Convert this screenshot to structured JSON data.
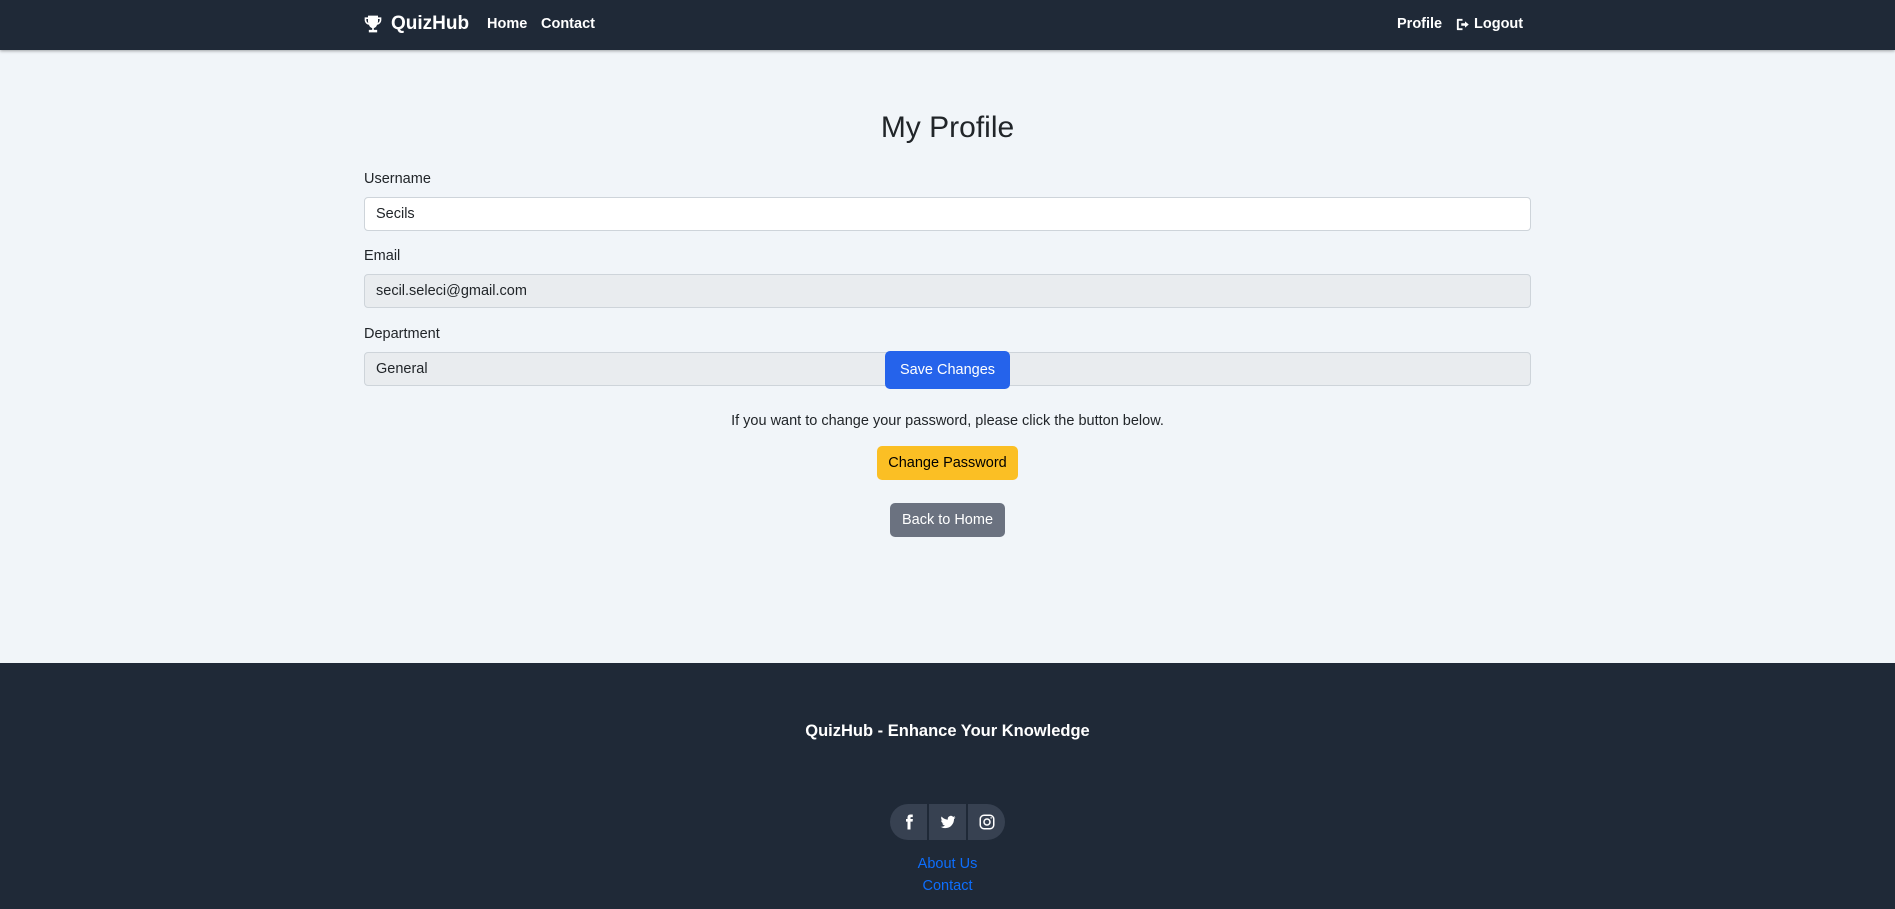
{
  "navbar": {
    "brand": "QuizHub",
    "brand_icon": "trophy-icon",
    "links": {
      "home": "Home",
      "contact": "Contact"
    },
    "right": {
      "profile": "Profile",
      "logout": "Logout",
      "logout_icon": "sign-out-icon"
    }
  },
  "profile": {
    "title": "My Profile",
    "fields": {
      "username": {
        "label": "Username",
        "value": "Secils"
      },
      "email": {
        "label": "Email",
        "value": "secil.seleci@gmail.com"
      },
      "department": {
        "label": "Department",
        "value": "General"
      }
    },
    "save_label": "Save Changes",
    "password_note": "If you want to change your password, please click the button below.",
    "change_password_label": "Change Password",
    "back_label": "Back to Home"
  },
  "footer": {
    "title": "QuizHub - Enhance Your Knowledge",
    "social_icons": [
      "facebook-icon",
      "twitter-icon",
      "instagram-icon"
    ],
    "links": {
      "about": "About Us",
      "contact": "Contact"
    }
  },
  "colors": {
    "navbar_bg": "#1f2937",
    "page_bg": "#f1f5f9",
    "primary": "#2563eb",
    "warning": "#fbbf24",
    "secondary": "#6b7280",
    "link": "#0d6efd"
  }
}
